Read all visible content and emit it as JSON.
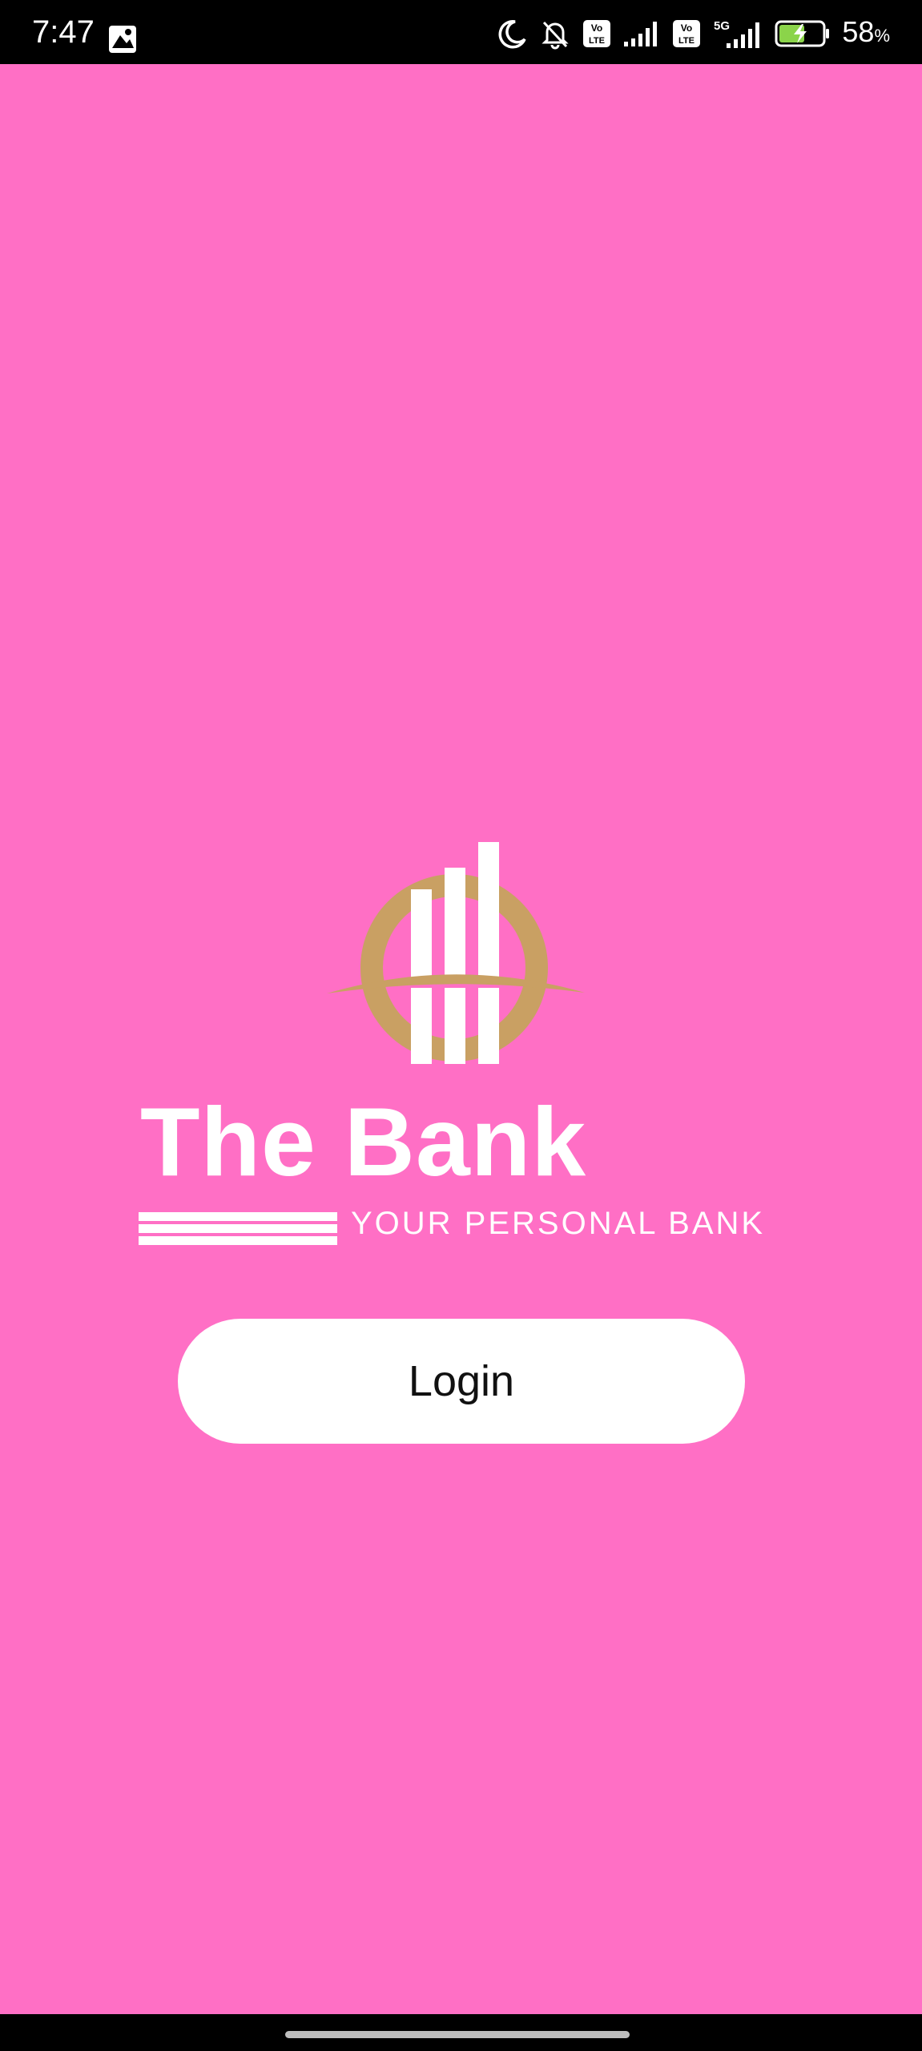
{
  "status_bar": {
    "time": "7:47",
    "battery_percent": "58",
    "battery_unit": "%",
    "network_label": "5G",
    "volte_label_top": "Vo",
    "volte_label_bottom": "LTE",
    "icons": [
      "gallery-notification-icon",
      "moon-icon",
      "bell-muted-icon",
      "volte-icon",
      "signal-icon",
      "volte-icon",
      "5g-signal-icon",
      "battery-charging-icon"
    ]
  },
  "brand": {
    "name": "The Bank",
    "tagline": "YOUR PERSONAL BANK",
    "logo_icon": "bank-bars-ring-logo",
    "colors": {
      "background": "#ff6fc5",
      "logo_ring": "#c9a063",
      "text": "#ffffff"
    }
  },
  "login": {
    "label": "Login"
  },
  "nav": {
    "home_indicator": "home-indicator"
  }
}
